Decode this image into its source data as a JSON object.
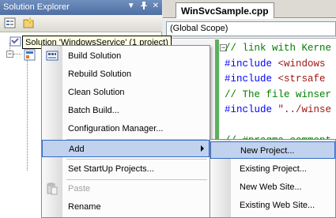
{
  "solution_explorer": {
    "title": "Solution Explorer",
    "title_buttons": [
      "▼",
      "ꟷ",
      "✕"
    ],
    "solution_label": "Solution 'WindowsService' (1 project)"
  },
  "editor": {
    "tab_label": "WinSvcSample.cpp",
    "scope": "(Global Scope)",
    "code_lines": [
      {
        "parts": [
          {
            "t": "// link with Kerne",
            "c": "cmt"
          }
        ]
      },
      {
        "parts": [
          {
            "t": "#include ",
            "c": "kw"
          },
          {
            "t": "<windows",
            "c": "str"
          }
        ]
      },
      {
        "parts": [
          {
            "t": "#include ",
            "c": "kw"
          },
          {
            "t": "<strsafe",
            "c": "str"
          }
        ]
      },
      {
        "parts": [
          {
            "t": "// The file winser",
            "c": "cmt"
          }
        ]
      },
      {
        "parts": [
          {
            "t": "#include ",
            "c": "kw"
          },
          {
            "t": "\"../winse",
            "c": "str"
          }
        ]
      },
      {
        "parts": [
          {
            "t": "",
            "c": ""
          }
        ]
      },
      {
        "parts": [
          {
            "t": "// #pragma comment",
            "c": "cmt"
          }
        ]
      }
    ]
  },
  "context_menu": {
    "items": [
      {
        "label": "Build Solution",
        "icon": "build-icon"
      },
      {
        "label": "Rebuild Solution"
      },
      {
        "label": "Clean Solution"
      },
      {
        "label": "Batch Build..."
      },
      {
        "label": "Configuration Manager..."
      },
      {
        "label": "Add",
        "submenu": true,
        "highlighted": true
      },
      {
        "label": "Set StartUp Projects..."
      },
      {
        "label": "Paste",
        "icon": "paste-icon",
        "disabled": true
      },
      {
        "label": "Rename"
      }
    ]
  },
  "add_submenu": {
    "items": [
      {
        "label": "New Project...",
        "highlighted": true
      },
      {
        "label": "Existing Project..."
      },
      {
        "label": "New Web Site..."
      },
      {
        "label": "Existing Web Site..."
      }
    ]
  },
  "colors": {
    "highlight": "#c1d2ee",
    "highlight_border": "#316ac5",
    "title_bar": "#5a7ab0",
    "comment": "#008000",
    "keyword": "#0000ff",
    "string": "#a31515"
  }
}
